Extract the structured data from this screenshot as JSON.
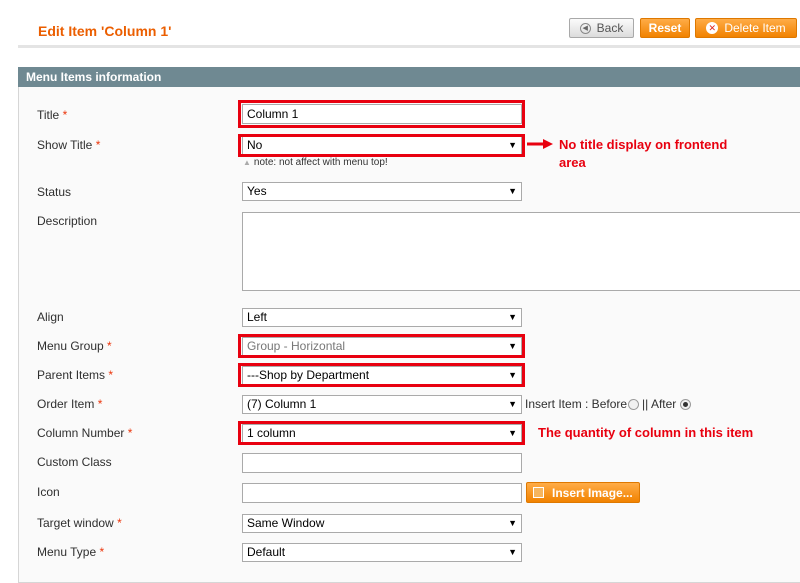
{
  "header": {
    "title": "Edit Item 'Column 1'",
    "back_label": "Back",
    "reset_label": "Reset",
    "delete_label": "Delete Item"
  },
  "section": {
    "title": "Menu Items information"
  },
  "fields": {
    "title": {
      "label": "Title",
      "req": "*",
      "value": "Column 1"
    },
    "show_title": {
      "label": "Show Title",
      "req": "*",
      "value": "No",
      "note": "note: not affect with menu top!"
    },
    "status": {
      "label": "Status",
      "value": "Yes"
    },
    "description": {
      "label": "Description",
      "value": ""
    },
    "align": {
      "label": "Align",
      "value": "Left"
    },
    "menu_group": {
      "label": "Menu Group",
      "req": "*",
      "value": "Group - Horizontal"
    },
    "parent_items": {
      "label": "Parent Items",
      "req": "*",
      "value": "---Shop by Department"
    },
    "order_item": {
      "label": "Order Item",
      "req": "*",
      "value": "(7) Column 1",
      "insert_label": "Insert Item : Before",
      "after_label": "|| After",
      "selected": "After"
    },
    "column_number": {
      "label": "Column Number",
      "req": "*",
      "value": "1 column"
    },
    "custom_class": {
      "label": "Custom Class",
      "value": ""
    },
    "icon": {
      "label": "Icon",
      "value": "",
      "insert_image_label": "Insert Image..."
    },
    "target_window": {
      "label": "Target window",
      "req": "*",
      "value": "Same Window"
    },
    "menu_type": {
      "label": "Menu Type",
      "req": "*",
      "value": "Default"
    }
  },
  "annotations": {
    "show_title_line1": "No title display on frontend",
    "show_title_line2": "area",
    "column_number": "The quantity of column in this item"
  },
  "colors": {
    "accent_orange": "#eb5e00",
    "section_header": "#6f8992",
    "highlight_red": "#e8000f"
  },
  "icons": {
    "back": "back-arrow-circle-icon",
    "delete": "delete-x-circle-icon",
    "insert_image": "image-icon",
    "select_arrow": "dropdown-arrow-icon",
    "note": "triangle-note-icon",
    "annotation_arrow": "red-arrow-icon"
  }
}
